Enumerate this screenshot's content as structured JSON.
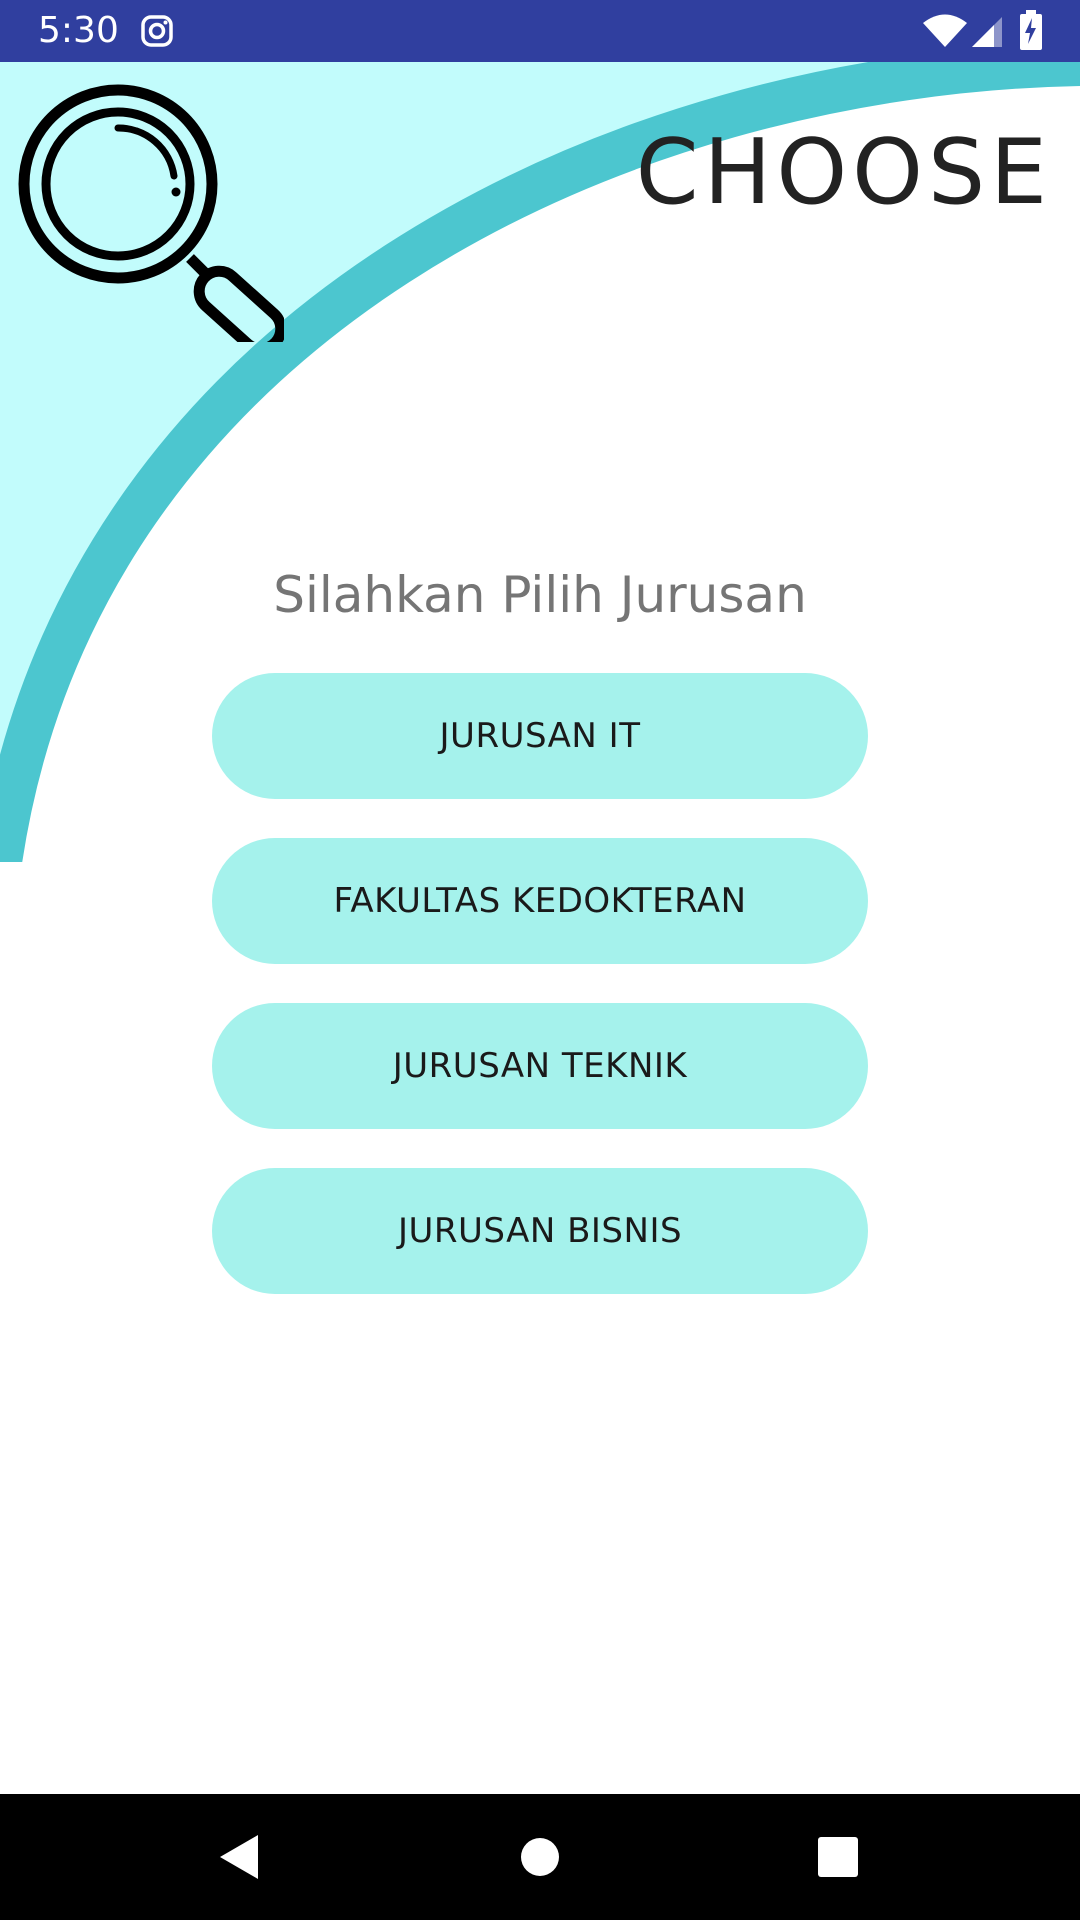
{
  "status_bar": {
    "time": "5:30",
    "icons": [
      "instagram-icon",
      "wifi-icon",
      "signal-icon",
      "battery-charging-icon"
    ]
  },
  "header": {
    "title": "CHOOSE",
    "icon": "magnifier-icon"
  },
  "main": {
    "prompt": "Silahkan Pilih Jurusan",
    "buttons": [
      {
        "label": "JURUSAN IT"
      },
      {
        "label": "FAKULTAS KEDOKTERAN"
      },
      {
        "label": "JURUSAN TEKNIK"
      },
      {
        "label": "JURUSAN BISNIS"
      }
    ]
  },
  "nav_bar": {
    "icons": [
      "back-icon",
      "home-icon",
      "recents-icon"
    ]
  },
  "colors": {
    "status_bar": "#303f9f",
    "header_fill": "#c2fcfc",
    "header_arc": "#4cc6cf",
    "button_bg": "#a5f2ec",
    "nav_bar": "#000000"
  }
}
